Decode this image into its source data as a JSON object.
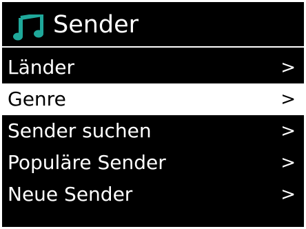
{
  "header": {
    "title": "Sender",
    "icon": "music-note-icon",
    "icon_color": "#1fa89a"
  },
  "menu": {
    "items": [
      {
        "label": "Länder",
        "arrow": ">",
        "selected": false
      },
      {
        "label": "Genre",
        "arrow": ">",
        "selected": true
      },
      {
        "label": "Sender suchen",
        "arrow": ">",
        "selected": false
      },
      {
        "label": "Populäre Sender",
        "arrow": ">",
        "selected": false
      },
      {
        "label": "Neue Sender",
        "arrow": ">",
        "selected": false
      }
    ]
  },
  "colors": {
    "background": "#000000",
    "text": "#ffffff",
    "highlight_background": "#ffffff",
    "highlight_text": "#000000"
  }
}
